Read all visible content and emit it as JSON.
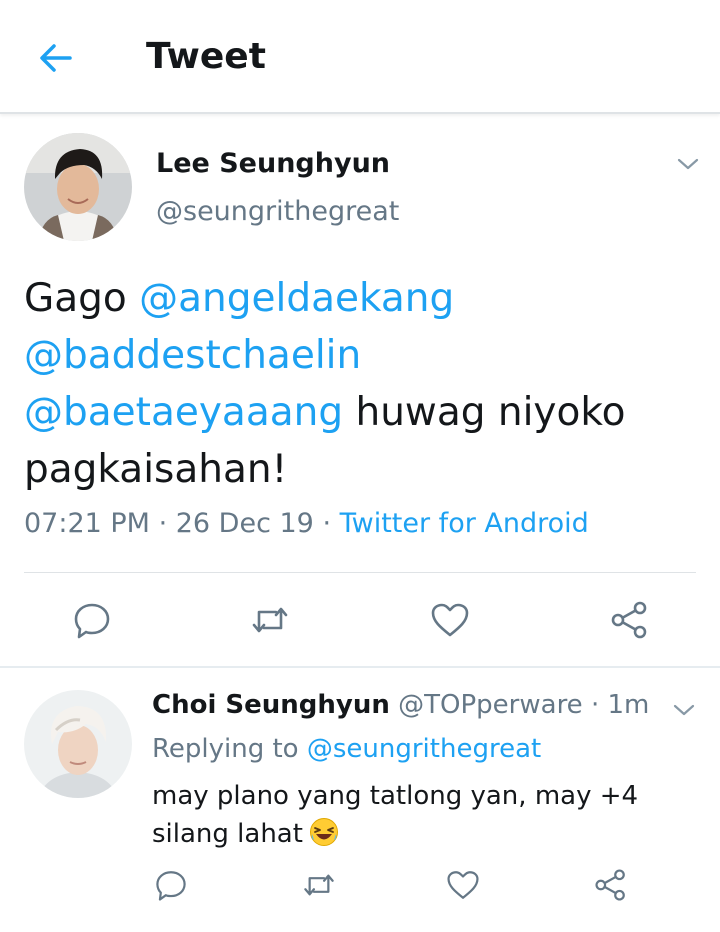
{
  "header": {
    "title": "Tweet",
    "back_icon": "arrow-left-icon"
  },
  "tweet": {
    "name": "Lee Seunghyun",
    "handle": "@seungrithegreat",
    "text_parts": {
      "p1": "Gago ",
      "m1": "@angeldaekang",
      "m2": "@baddestchaelin",
      "m3": "@baetaeyaaang",
      "p2": " huwag niyoko pagkaisahan!"
    },
    "time": "07:21 PM",
    "sep1": " · ",
    "date": "26 Dec 19",
    "sep2": " · ",
    "source": "Twitter for Android"
  },
  "reply": {
    "name": "Choi Seunghyun",
    "handle": "@TOPperware",
    "sep": " · ",
    "age": "1m",
    "replying_label": "Replying to ",
    "replying_to": "@seungrithegreat",
    "text": "may plano yang tatlong yan, may +4 silang lahat"
  },
  "colors": {
    "accent": "#1da1f2",
    "secondary": "#657786",
    "text": "#14171a"
  },
  "icons": [
    "reply-icon",
    "retweet-icon",
    "like-icon",
    "share-icon",
    "chevron-down-icon",
    "laughing-emoji"
  ]
}
